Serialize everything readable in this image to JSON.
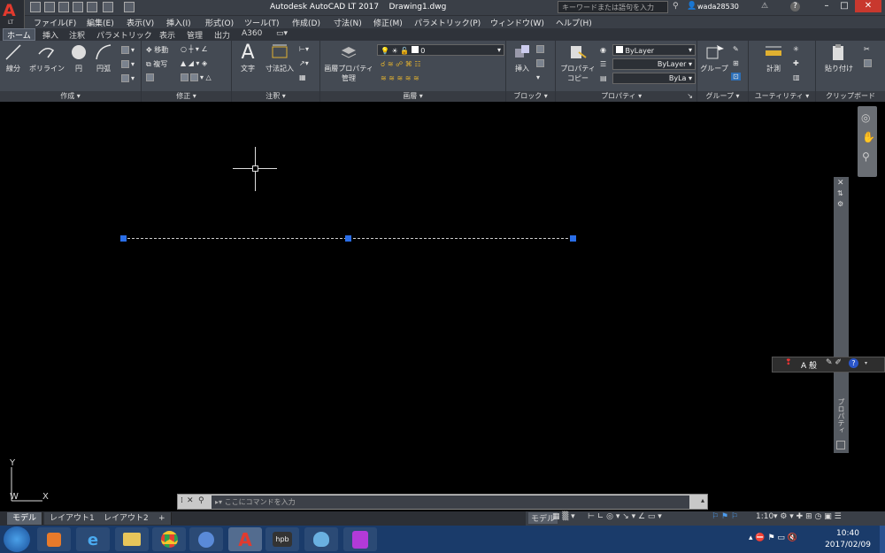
{
  "app": {
    "logo_letter": "A",
    "logo_sub": "LT",
    "title": "Autodesk AutoCAD LT 2017",
    "filename": "Drawing1.dwg",
    "search_placeholder": "キーワードまたは語句を入力",
    "user": "wada28530"
  },
  "menu": [
    "ファイル(F)",
    "編集(E)",
    "表示(V)",
    "挿入(I)",
    "形式(O)",
    "ツール(T)",
    "作成(D)",
    "寸法(N)",
    "修正(M)",
    "パラメトリック(P)",
    "ウィンドウ(W)",
    "ヘルプ(H)"
  ],
  "tabs": [
    "ホーム",
    "挿入",
    "注釈",
    "パラメトリック",
    "表示",
    "管理",
    "出力",
    "A360"
  ],
  "ribbon": {
    "draw": {
      "line": "線分",
      "polyline": "ポリライン",
      "circle": "円",
      "arc": "円弧",
      "label": "作成"
    },
    "modify": {
      "move": "移動",
      "copy": "複写",
      "label": "修正"
    },
    "annotation": {
      "text": "文字",
      "dimension": "寸法記入",
      "label": "注釈"
    },
    "layers": {
      "props": "画層プロパティ",
      "manage": "管理",
      "current": "0",
      "label": "画層"
    },
    "block": {
      "insert": "挿入",
      "label": "ブロック"
    },
    "properties": {
      "copy1": "プロパティ",
      "copy2": "コピー",
      "color": "ByLayer",
      "linetype": "ByLayer",
      "lineweight": "ByLa",
      "label": "プロパティ"
    },
    "groups": {
      "group": "グループ",
      "label": "グループ"
    },
    "utilities": {
      "measure": "計測",
      "label": "ユーティリティ"
    },
    "clipboard": {
      "paste": "貼り付け",
      "label": "クリップボード"
    }
  },
  "canvas": {
    "ucs_y": "Y",
    "ucs_w": "W",
    "ucs_x": "X",
    "props_strip": "プロパティ"
  },
  "command": {
    "placeholder": "ここにコマンドを入力"
  },
  "layouts": [
    "モデル",
    "レイアウト1",
    "レイアウト2"
  ],
  "status": {
    "model": "モデル",
    "scale": "1:10"
  },
  "ime": {
    "mode": "A 般"
  },
  "clock": {
    "time": "10:40",
    "date": "2017/02/09"
  }
}
